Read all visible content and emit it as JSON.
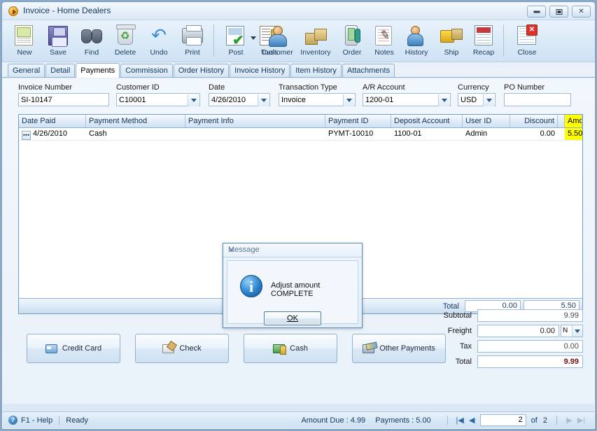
{
  "window": {
    "title": "Invoice - Home Dealers",
    "icon": "play-circle-icon",
    "controls": {
      "minimize": "minimize-icon",
      "maximize": "maximize-icon",
      "close": "close-icon"
    }
  },
  "toolbar": {
    "buttons": [
      {
        "label": "New",
        "icon": "new-document-icon"
      },
      {
        "label": "Save",
        "icon": "floppy-disk-icon"
      },
      {
        "label": "Find",
        "icon": "binoculars-icon"
      },
      {
        "label": "Delete",
        "icon": "recycle-bin-icon"
      },
      {
        "label": "Undo",
        "icon": "undo-arrow-icon"
      },
      {
        "label": "Print",
        "icon": "printer-icon"
      },
      {
        "label": "Post",
        "icon": "post-check-icon"
      },
      {
        "label": "Tools",
        "icon": "tools-icon"
      },
      {
        "label": "Customer",
        "icon": "customer-person-icon"
      },
      {
        "label": "Inventory",
        "icon": "boxes-icon"
      },
      {
        "label": "Order",
        "icon": "order-pda-icon"
      },
      {
        "label": "Notes",
        "icon": "notepad-pen-icon"
      },
      {
        "label": "History",
        "icon": "history-person-icon"
      },
      {
        "label": "Ship",
        "icon": "forklift-icon"
      },
      {
        "label": "Recap",
        "icon": "recap-report-icon"
      },
      {
        "label": "Close",
        "icon": "close-window-icon"
      }
    ]
  },
  "tabs": [
    {
      "label": "General",
      "active": false
    },
    {
      "label": "Detail",
      "active": false
    },
    {
      "label": "Payments",
      "active": true
    },
    {
      "label": "Commission",
      "active": false
    },
    {
      "label": "Order History",
      "active": false
    },
    {
      "label": "Invoice History",
      "active": false
    },
    {
      "label": "Item History",
      "active": false
    },
    {
      "label": "Attachments",
      "active": false
    }
  ],
  "fields": {
    "invoice_number": {
      "label": "Invoice Number",
      "value": "SI-10147",
      "type": "text"
    },
    "customer_id": {
      "label": "Customer ID",
      "value": "C10001",
      "type": "combo"
    },
    "date": {
      "label": "Date",
      "value": "4/26/2010",
      "type": "combo"
    },
    "transaction_type": {
      "label": "Transaction Type",
      "value": "Invoice",
      "type": "combo"
    },
    "ar_account": {
      "label": "A/R Account",
      "value": "1200-01",
      "type": "combo"
    },
    "currency": {
      "label": "Currency",
      "value": "USD",
      "type": "combo"
    },
    "po_number": {
      "label": "PO Number",
      "value": "",
      "type": "text"
    }
  },
  "grid": {
    "columns": [
      {
        "label": "Date Paid",
        "align": "left",
        "highlight": false
      },
      {
        "label": "Payment Method",
        "align": "left",
        "highlight": false
      },
      {
        "label": "Payment Info",
        "align": "left",
        "highlight": false
      },
      {
        "label": "Payment ID",
        "align": "left",
        "highlight": false
      },
      {
        "label": "Deposit Account",
        "align": "left",
        "highlight": false
      },
      {
        "label": "User ID",
        "align": "left",
        "highlight": false
      },
      {
        "label": "Discount",
        "align": "right",
        "highlight": false
      },
      {
        "label": "Amount",
        "align": "right",
        "highlight": true
      }
    ],
    "rows": [
      {
        "date_paid": "4/26/2010",
        "payment_method": "Cash",
        "payment_info": "",
        "payment_id": "PYMT-10010",
        "deposit_account": "1100-01",
        "user_id": "Admin",
        "discount": "0.00",
        "amount": "5.50"
      }
    ],
    "footer": {
      "label": "Total",
      "discount_total": "0.00",
      "amount_total": "5.50"
    }
  },
  "payment_buttons": [
    {
      "label": "Credit Card",
      "icon": "credit-card-icon"
    },
    {
      "label": "Check",
      "icon": "check-icon"
    },
    {
      "label": "Cash",
      "icon": "cash-icon"
    },
    {
      "label": "Other Payments",
      "icon": "other-payments-icon"
    }
  ],
  "totals": [
    {
      "label": "Subtotal",
      "value": "9.99",
      "emphasis": "normal",
      "suffix": null
    },
    {
      "label": "Freight",
      "value": "0.00",
      "emphasis": "dark",
      "suffix": "N"
    },
    {
      "label": "Tax",
      "value": "0.00",
      "emphasis": "normal",
      "suffix": null
    },
    {
      "label": "Total",
      "value": "9.99",
      "emphasis": "bold",
      "suffix": null
    }
  ],
  "statusbar": {
    "help": "F1 - Help",
    "help_icon": "question-mark-icon",
    "state": "Ready",
    "amount_due": "Amount Due : 4.99",
    "payments": "Payments : 5.00",
    "nav": {
      "first_icon": "first-record-icon",
      "prev_icon": "previous-record-icon",
      "next_icon": "next-record-icon",
      "last_icon": "last-record-icon",
      "page": "2",
      "of_label": "of",
      "total_pages": "2"
    }
  },
  "dialog": {
    "title": "Message",
    "close_icon": "close-icon",
    "icon": "information-icon",
    "message": "Adjust amount COMPLETE",
    "ok_label": "OK"
  },
  "colors": {
    "highlight": "#ffff00",
    "total_red": "#7a0b0b",
    "accent_blue": "#2a82cd"
  }
}
